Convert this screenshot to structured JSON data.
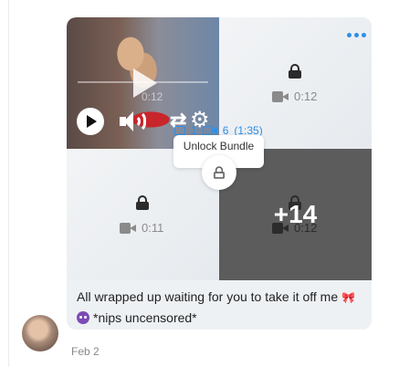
{
  "post": {
    "video_tile": {
      "duration_ghost": "0:12",
      "progress": 0,
      "media_counts": {
        "images": "1",
        "videos": "6",
        "video_length": "(1:35)"
      }
    },
    "locked_tiles": [
      {
        "duration": "0:12"
      },
      {
        "duration": "0:11"
      },
      {
        "duration": "0:12",
        "more_label": "+14"
      }
    ],
    "unlock": {
      "tooltip": "Unlock Bundle"
    },
    "caption_line1": "All wrapped up waiting for you to take it off me",
    "caption_bow": "🎀",
    "caption_line2": "*nips uncensored*",
    "date": "Feb 2"
  },
  "colors": {
    "accent": "#2f8fe5",
    "bubble": "#eef1f4",
    "locked_overlay": "#5c5c5c"
  },
  "icons": [
    "play-icon",
    "volume-icon",
    "loop-icon",
    "settings-icon",
    "lock-icon",
    "video-camera-icon",
    "image-icon",
    "more-icon"
  ]
}
